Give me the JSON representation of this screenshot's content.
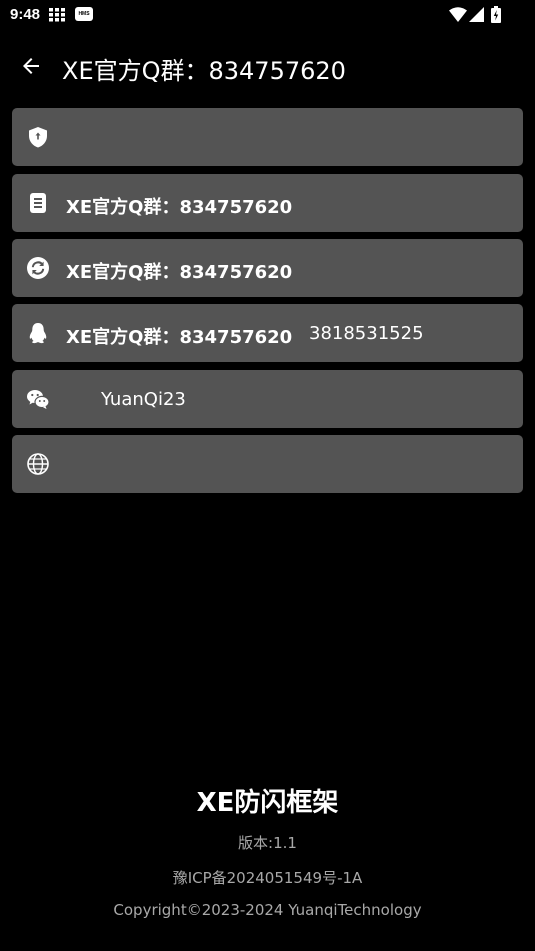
{
  "status_bar": {
    "time": "9:48",
    "hms_badge": "HMS",
    "icons": [
      "grid-icon",
      "hms-icon",
      "wifi-icon",
      "signal-icon",
      "battery-charging-icon"
    ]
  },
  "app_bar": {
    "title": "XE官方Q群：834757620",
    "back_icon": "arrow-left-icon"
  },
  "cards": [
    {
      "icon": "shield-icon",
      "label": "",
      "value": ""
    },
    {
      "icon": "document-icon",
      "label": "XE官方Q群：834757620",
      "value": ""
    },
    {
      "icon": "refresh-icon",
      "label": "XE官方Q群：834757620",
      "value": ""
    },
    {
      "icon": "qq-icon",
      "label": "XE官方Q群：834757620",
      "value": "3818531525"
    },
    {
      "icon": "wechat-icon",
      "label": "",
      "value": "YuanQi23"
    },
    {
      "icon": "globe-icon",
      "label": "",
      "value": ""
    }
  ],
  "footer": {
    "app_name": "XE防闪框架",
    "version": "版本:1.1",
    "icp": "豫ICP备2024051549号-1A",
    "copyright": "Copyright©2023-2024 YuanqiTechnology"
  },
  "colors": {
    "background": "#000000",
    "card": "#545454",
    "text": "#ffffff",
    "footer_text": "#a8a8a8"
  }
}
